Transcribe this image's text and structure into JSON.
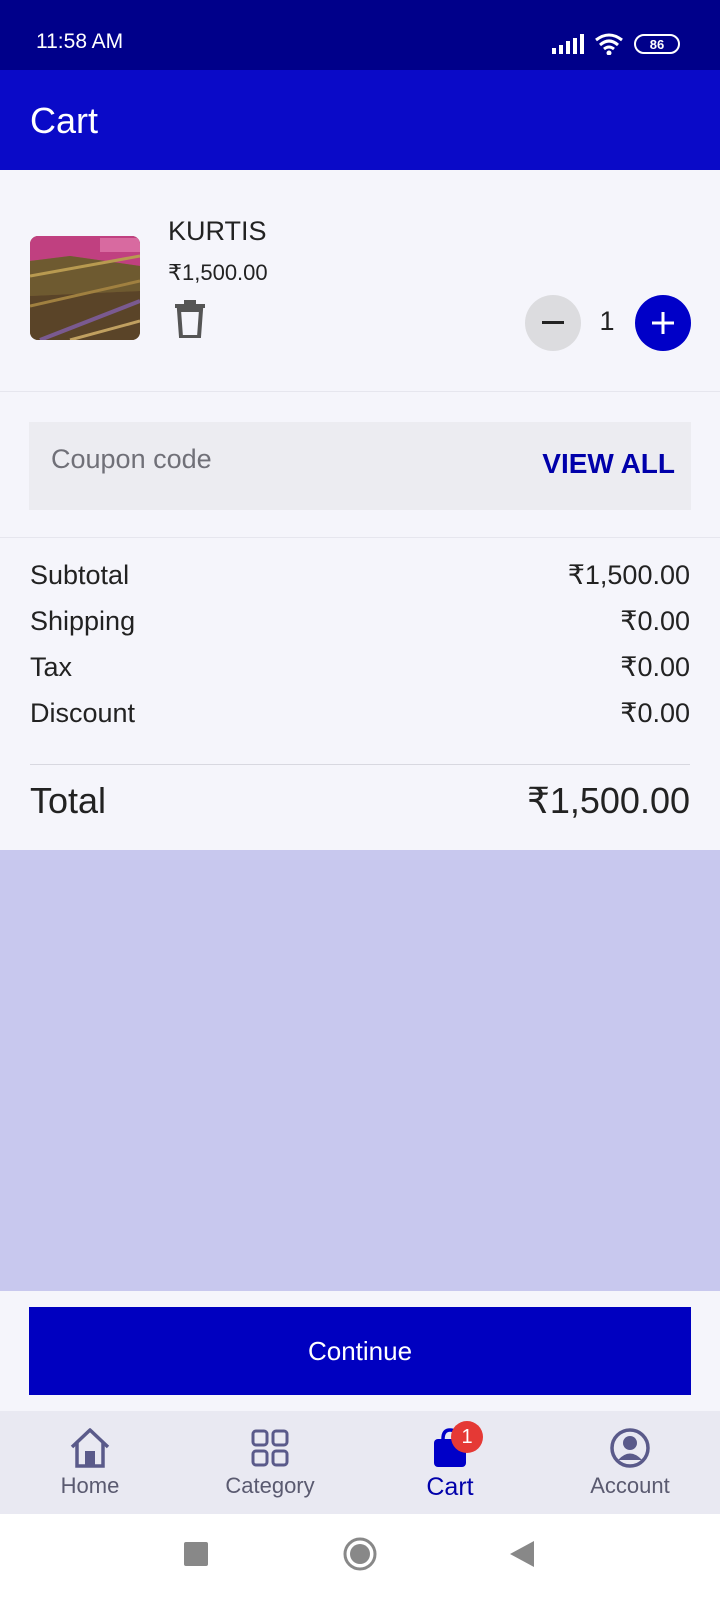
{
  "status": {
    "time": "11:58 AM",
    "battery": "86"
  },
  "app_bar": {
    "title": "Cart"
  },
  "cart_item": {
    "name": "KURTIS",
    "price": "₹1,500.00",
    "quantity": "1"
  },
  "coupon": {
    "placeholder": "Coupon code",
    "view_all": "VIEW ALL"
  },
  "summary": {
    "subtotal_label": "Subtotal",
    "subtotal": "₹1,500.00",
    "shipping_label": "Shipping",
    "shipping": "₹0.00",
    "tax_label": "Tax",
    "tax": "₹0.00",
    "discount_label": "Discount",
    "discount": "₹0.00",
    "total_label": "Total",
    "total": "₹1,500.00"
  },
  "continue_label": "Continue",
  "nav": {
    "items": [
      {
        "label": "Home",
        "icon": "home-icon"
      },
      {
        "label": "Category",
        "icon": "grid-icon"
      },
      {
        "label": "Cart",
        "icon": "shopping-bag-icon",
        "badge": "1"
      },
      {
        "label": "Account",
        "icon": "account-icon"
      }
    ]
  },
  "colors": {
    "status_bar": "#00008a",
    "app_bar": "#0a0ac8",
    "accent": "#0000c8",
    "badge": "#e53935",
    "filler": "#c8c8ee"
  }
}
